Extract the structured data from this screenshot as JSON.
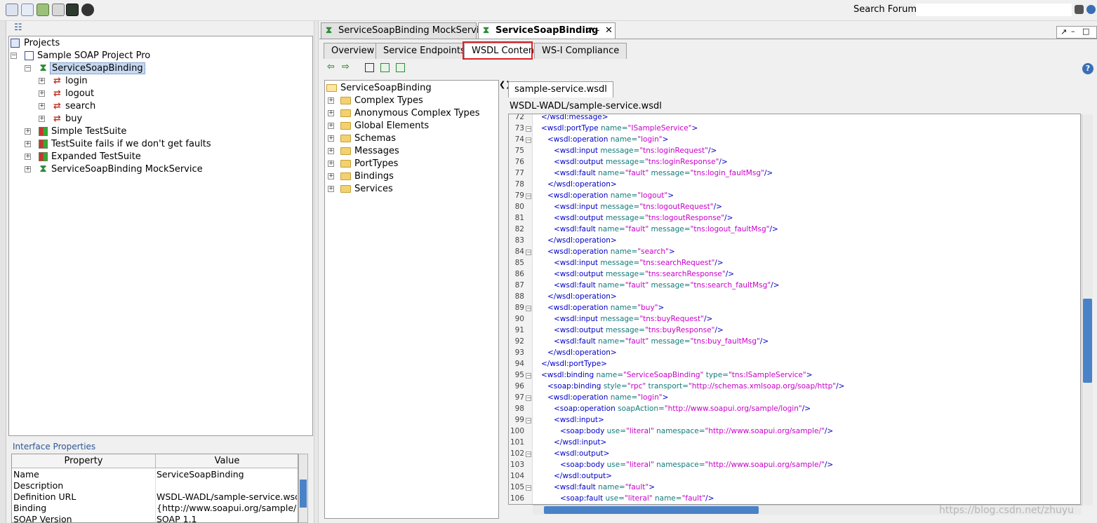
{
  "toolbar": {
    "search_label": "Search Forum",
    "search_value": "",
    "icons": [
      "new-project-icon",
      "import-icon",
      "preferences-icon",
      "tools-icon",
      "monitor-icon",
      "help-icon"
    ]
  },
  "navigator": {
    "root_label": "Projects",
    "project": "Sample SOAP Project Pro",
    "interface": "ServiceSoapBinding",
    "operations": [
      "login",
      "logout",
      "search",
      "buy"
    ],
    "suites": [
      "Simple TestSuite",
      "TestSuite fails if we don't get faults",
      "Expanded TestSuite",
      "ServiceSoapBinding MockService"
    ]
  },
  "properties": {
    "title": "Interface Properties",
    "headers": [
      "Property",
      "Value"
    ],
    "rows": [
      {
        "name": "Name",
        "value": "ServiceSoapBinding"
      },
      {
        "name": "Description",
        "value": ""
      },
      {
        "name": "Definition URL",
        "value": "WSDL-WADL/sample-service.wsdl"
      },
      {
        "name": "Binding",
        "value": "{http://www.soapui.org/sample/}..."
      },
      {
        "name": "SOAP Version",
        "value": "SOAP 1.1"
      }
    ]
  },
  "doc_tabs": [
    {
      "label": "ServiceSoapBinding MockService",
      "active": false
    },
    {
      "label": "ServiceSoapBinding",
      "active": true
    }
  ],
  "sub_tabs": [
    "Overview",
    "Service Endpoints",
    "WSDL Content",
    "WS-I Compliance"
  ],
  "active_sub_tab": "WSDL Content",
  "wsdl_tree": {
    "root": "ServiceSoapBinding",
    "folders": [
      "Complex Types",
      "Anonymous Complex Types",
      "Global Elements",
      "Schemas",
      "Messages",
      "PortTypes",
      "Bindings",
      "Services"
    ]
  },
  "editor": {
    "file_tab": "sample-service.wsdl",
    "file_path": "WSDL-WADL/sample-service.wsdl",
    "watermark": "https://blog.csdn.net/zhuyu",
    "lines": [
      {
        "n": "72",
        "fold": false,
        "indent": 0,
        "parts": [
          [
            "tg",
            "</wsdl:message>"
          ]
        ]
      },
      {
        "n": "73",
        "fold": true,
        "indent": 0,
        "parts": [
          [
            "tg",
            "<wsdl:portType "
          ],
          [
            "at",
            "name="
          ],
          [
            "vl",
            "\"ISampleService\""
          ],
          [
            "tg",
            ">"
          ]
        ]
      },
      {
        "n": "74",
        "fold": true,
        "indent": 1,
        "parts": [
          [
            "tg",
            "<wsdl:operation "
          ],
          [
            "at",
            "name="
          ],
          [
            "vl",
            "\"login\""
          ],
          [
            "tg",
            ">"
          ]
        ]
      },
      {
        "n": "75",
        "fold": false,
        "indent": 2,
        "parts": [
          [
            "tg",
            "<wsdl:input "
          ],
          [
            "at",
            "message="
          ],
          [
            "vl",
            "\"tns:loginRequest\""
          ],
          [
            "tg",
            "/>"
          ]
        ]
      },
      {
        "n": "76",
        "fold": false,
        "indent": 2,
        "parts": [
          [
            "tg",
            "<wsdl:output "
          ],
          [
            "at",
            "message="
          ],
          [
            "vl",
            "\"tns:loginResponse\""
          ],
          [
            "tg",
            "/>"
          ]
        ]
      },
      {
        "n": "77",
        "fold": false,
        "indent": 2,
        "parts": [
          [
            "tg",
            "<wsdl:fault "
          ],
          [
            "at",
            "name="
          ],
          [
            "vl",
            "\"fault\""
          ],
          [
            "at",
            " message="
          ],
          [
            "vl",
            "\"tns:login_faultMsg\""
          ],
          [
            "tg",
            "/>"
          ]
        ]
      },
      {
        "n": "78",
        "fold": false,
        "indent": 1,
        "parts": [
          [
            "tg",
            "</wsdl:operation>"
          ]
        ]
      },
      {
        "n": "79",
        "fold": true,
        "indent": 1,
        "parts": [
          [
            "tg",
            "<wsdl:operation "
          ],
          [
            "at",
            "name="
          ],
          [
            "vl",
            "\"logout\""
          ],
          [
            "tg",
            ">"
          ]
        ]
      },
      {
        "n": "80",
        "fold": false,
        "indent": 2,
        "parts": [
          [
            "tg",
            "<wsdl:input "
          ],
          [
            "at",
            "message="
          ],
          [
            "vl",
            "\"tns:logoutRequest\""
          ],
          [
            "tg",
            "/>"
          ]
        ]
      },
      {
        "n": "81",
        "fold": false,
        "indent": 2,
        "parts": [
          [
            "tg",
            "<wsdl:output "
          ],
          [
            "at",
            "message="
          ],
          [
            "vl",
            "\"tns:logoutResponse\""
          ],
          [
            "tg",
            "/>"
          ]
        ]
      },
      {
        "n": "82",
        "fold": false,
        "indent": 2,
        "parts": [
          [
            "tg",
            "<wsdl:fault "
          ],
          [
            "at",
            "name="
          ],
          [
            "vl",
            "\"fault\""
          ],
          [
            "at",
            " message="
          ],
          [
            "vl",
            "\"tns:logout_faultMsg\""
          ],
          [
            "tg",
            "/>"
          ]
        ]
      },
      {
        "n": "83",
        "fold": false,
        "indent": 1,
        "parts": [
          [
            "tg",
            "</wsdl:operation>"
          ]
        ]
      },
      {
        "n": "84",
        "fold": true,
        "indent": 1,
        "parts": [
          [
            "tg",
            "<wsdl:operation "
          ],
          [
            "at",
            "name="
          ],
          [
            "vl",
            "\"search\""
          ],
          [
            "tg",
            ">"
          ]
        ]
      },
      {
        "n": "85",
        "fold": false,
        "indent": 2,
        "parts": [
          [
            "tg",
            "<wsdl:input "
          ],
          [
            "at",
            "message="
          ],
          [
            "vl",
            "\"tns:searchRequest\""
          ],
          [
            "tg",
            "/>"
          ]
        ]
      },
      {
        "n": "86",
        "fold": false,
        "indent": 2,
        "parts": [
          [
            "tg",
            "<wsdl:output "
          ],
          [
            "at",
            "message="
          ],
          [
            "vl",
            "\"tns:searchResponse\""
          ],
          [
            "tg",
            "/>"
          ]
        ]
      },
      {
        "n": "87",
        "fold": false,
        "indent": 2,
        "parts": [
          [
            "tg",
            "<wsdl:fault "
          ],
          [
            "at",
            "name="
          ],
          [
            "vl",
            "\"fault\""
          ],
          [
            "at",
            " message="
          ],
          [
            "vl",
            "\"tns:search_faultMsg\""
          ],
          [
            "tg",
            "/>"
          ]
        ]
      },
      {
        "n": "88",
        "fold": false,
        "indent": 1,
        "parts": [
          [
            "tg",
            "</wsdl:operation>"
          ]
        ]
      },
      {
        "n": "89",
        "fold": true,
        "indent": 1,
        "parts": [
          [
            "tg",
            "<wsdl:operation "
          ],
          [
            "at",
            "name="
          ],
          [
            "vl",
            "\"buy\""
          ],
          [
            "tg",
            ">"
          ]
        ]
      },
      {
        "n": "90",
        "fold": false,
        "indent": 2,
        "parts": [
          [
            "tg",
            "<wsdl:input "
          ],
          [
            "at",
            "message="
          ],
          [
            "vl",
            "\"tns:buyRequest\""
          ],
          [
            "tg",
            "/>"
          ]
        ]
      },
      {
        "n": "91",
        "fold": false,
        "indent": 2,
        "parts": [
          [
            "tg",
            "<wsdl:output "
          ],
          [
            "at",
            "message="
          ],
          [
            "vl",
            "\"tns:buyResponse\""
          ],
          [
            "tg",
            "/>"
          ]
        ]
      },
      {
        "n": "92",
        "fold": false,
        "indent": 2,
        "parts": [
          [
            "tg",
            "<wsdl:fault "
          ],
          [
            "at",
            "name="
          ],
          [
            "vl",
            "\"fault\""
          ],
          [
            "at",
            " message="
          ],
          [
            "vl",
            "\"tns:buy_faultMsg\""
          ],
          [
            "tg",
            "/>"
          ]
        ]
      },
      {
        "n": "93",
        "fold": false,
        "indent": 1,
        "parts": [
          [
            "tg",
            "</wsdl:operation>"
          ]
        ]
      },
      {
        "n": "94",
        "fold": false,
        "indent": 0,
        "parts": [
          [
            "tg",
            "</wsdl:portType>"
          ]
        ]
      },
      {
        "n": "95",
        "fold": true,
        "indent": 0,
        "parts": [
          [
            "tg",
            "<wsdl:binding "
          ],
          [
            "at",
            "name="
          ],
          [
            "vl",
            "\"ServiceSoapBinding\""
          ],
          [
            "at",
            " type="
          ],
          [
            "vl",
            "\"tns:ISampleService\""
          ],
          [
            "tg",
            ">"
          ]
        ]
      },
      {
        "n": "96",
        "fold": false,
        "indent": 1,
        "parts": [
          [
            "tg",
            "<soap:binding "
          ],
          [
            "at",
            "style="
          ],
          [
            "vl",
            "\"rpc\""
          ],
          [
            "at",
            " transport="
          ],
          [
            "vl",
            "\"http://schemas.xmlsoap.org/soap/http\""
          ],
          [
            "tg",
            "/>"
          ]
        ]
      },
      {
        "n": "97",
        "fold": true,
        "indent": 1,
        "parts": [
          [
            "tg",
            "<wsdl:operation "
          ],
          [
            "at",
            "name="
          ],
          [
            "vl",
            "\"login\""
          ],
          [
            "tg",
            ">"
          ]
        ]
      },
      {
        "n": "98",
        "fold": false,
        "indent": 2,
        "parts": [
          [
            "tg",
            "<soap:operation "
          ],
          [
            "at",
            "soapAction="
          ],
          [
            "vl",
            "\"http://www.soapui.org/sample/login\""
          ],
          [
            "tg",
            "/>"
          ]
        ]
      },
      {
        "n": "99",
        "fold": true,
        "indent": 2,
        "parts": [
          [
            "tg",
            "<wsdl:input>"
          ]
        ]
      },
      {
        "n": "100",
        "fold": false,
        "indent": 3,
        "parts": [
          [
            "tg",
            "<soap:body "
          ],
          [
            "at",
            "use="
          ],
          [
            "vl",
            "\"literal\""
          ],
          [
            "at",
            " namespace="
          ],
          [
            "vl",
            "\"http://www.soapui.org/sample/\""
          ],
          [
            "tg",
            "/>"
          ]
        ]
      },
      {
        "n": "101",
        "fold": false,
        "indent": 2,
        "parts": [
          [
            "tg",
            "</wsdl:input>"
          ]
        ]
      },
      {
        "n": "102",
        "fold": true,
        "indent": 2,
        "parts": [
          [
            "tg",
            "<wsdl:output>"
          ]
        ]
      },
      {
        "n": "103",
        "fold": false,
        "indent": 3,
        "parts": [
          [
            "tg",
            "<soap:body "
          ],
          [
            "at",
            "use="
          ],
          [
            "vl",
            "\"literal\""
          ],
          [
            "at",
            " namespace="
          ],
          [
            "vl",
            "\"http://www.soapui.org/sample/\""
          ],
          [
            "tg",
            "/>"
          ]
        ]
      },
      {
        "n": "104",
        "fold": false,
        "indent": 2,
        "parts": [
          [
            "tg",
            "</wsdl:output>"
          ]
        ]
      },
      {
        "n": "105",
        "fold": true,
        "indent": 2,
        "parts": [
          [
            "tg",
            "<wsdl:fault "
          ],
          [
            "at",
            "name="
          ],
          [
            "vl",
            "\"fault\""
          ],
          [
            "tg",
            ">"
          ]
        ]
      },
      {
        "n": "106",
        "fold": false,
        "indent": 3,
        "parts": [
          [
            "tg",
            "<soap:fault "
          ],
          [
            "at",
            "use="
          ],
          [
            "vl",
            "\"literal\""
          ],
          [
            "at",
            " name="
          ],
          [
            "vl",
            "\"fault\""
          ],
          [
            "tg",
            "/>"
          ]
        ]
      }
    ]
  }
}
